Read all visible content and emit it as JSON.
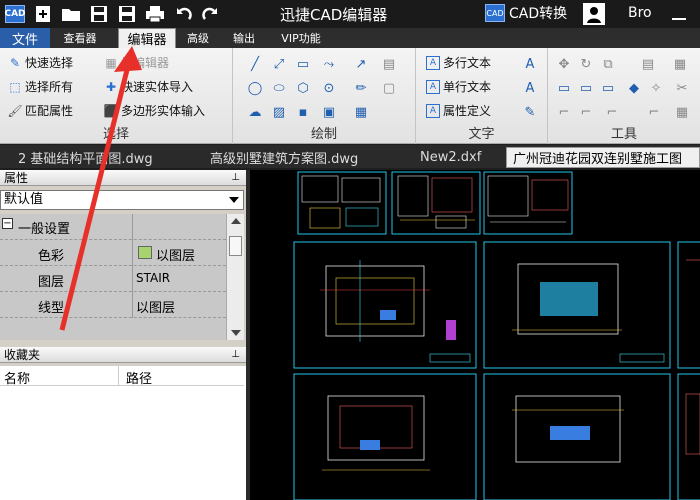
{
  "titlebar": {
    "app_logo": "CAD",
    "title": "迅捷CAD编辑器",
    "convert_badge": "CAD",
    "convert_label": "CAD转换",
    "user_name": "Bro"
  },
  "tabs": {
    "file": "文件",
    "viewer": "查看器",
    "editor": "编辑器",
    "advanced": "高级",
    "output": "输出",
    "vip": "VIP功能"
  },
  "ribbon": {
    "select": {
      "quick_select": "快速选择",
      "select_all": "选择所有",
      "match_props": "匹配属性",
      "block_editor": "块编辑器",
      "import_solids": "快速实体导入",
      "poly_solid_input": "多边形实体输入",
      "label": "选择"
    },
    "draw": {
      "label": "绘制"
    },
    "text": {
      "mtext": "多行文本",
      "stext": "单行文本",
      "attdef": "属性定义",
      "label": "文字"
    },
    "tools": {
      "label": "工具"
    }
  },
  "doc_tabs": [
    "2 基础结构平面图.dwg",
    "高级别墅建筑方案图.dwg",
    "New2.dxf",
    "广州冠迪花园双连别墅施工图"
  ],
  "properties": {
    "header": "属性",
    "dropdown_value": "默认值",
    "section": "一般设置",
    "rows": [
      {
        "key": "色彩",
        "value": "以图层"
      },
      {
        "key": "图层",
        "value": "STAIR"
      },
      {
        "key": "线型",
        "value": "以图层"
      }
    ],
    "swatch_color": "#a8d470"
  },
  "favorites": {
    "header": "收藏夹",
    "col_name": "名称",
    "col_path": "路径"
  },
  "colors": {
    "annotation_arrow": "#e8302a",
    "drawing_border": "#1fc4e8",
    "canvas": "#000000"
  }
}
